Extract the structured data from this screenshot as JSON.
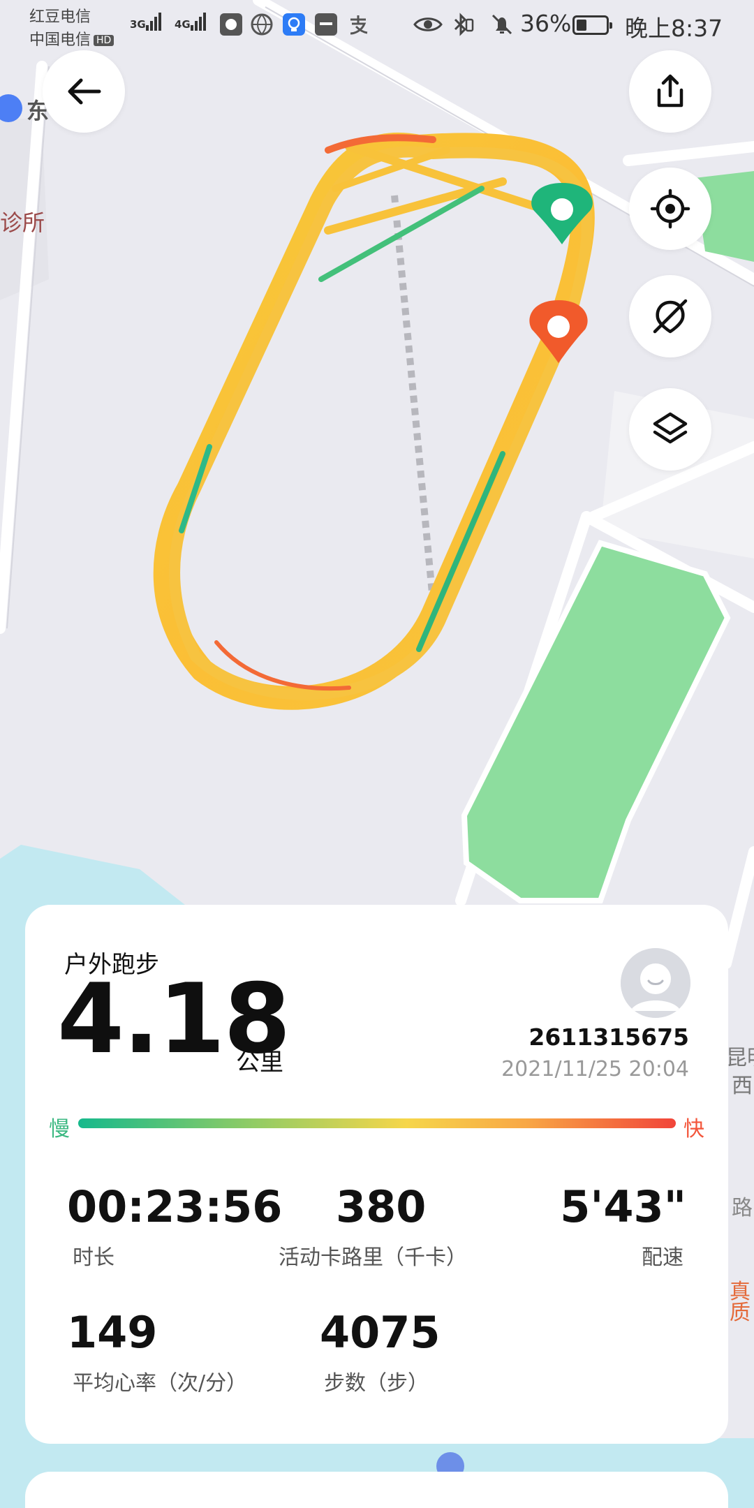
{
  "status_bar": {
    "carrier_1": "红豆电信",
    "carrier_2": "中国电信",
    "hd_badge": "HD",
    "net_1": "3G",
    "net_2": "4G",
    "battery_percent": "36%",
    "battery_level": 0.36,
    "time": "晚上8:37",
    "icons": [
      "signal-icon",
      "signal-icon",
      "app-icon",
      "globe-icon",
      "bulb-icon",
      "huawei-icon",
      "alipay-icon",
      "eye-icon",
      "bluetooth-icon",
      "vibrate-icon",
      "mute-icon",
      "battery-icon"
    ]
  },
  "map": {
    "labels": [
      "东",
      "诊所",
      "昆明",
      "西",
      "路",
      "真",
      "质"
    ],
    "colors": {
      "background": "#eaeaf0",
      "park": "#8ddd9e",
      "water": "#c2e9f1",
      "road": "#ffffff"
    }
  },
  "map_controls": {
    "back": "back-arrow-icon",
    "share": "share-icon",
    "locate": "locate-icon",
    "hide_route": "hide-route-icon",
    "layers": "layers-icon"
  },
  "route_markers": {
    "start_color": "#1fb57a",
    "end_color": "#f15a2b"
  },
  "summary": {
    "activity_type": "户外跑步",
    "distance": "4.18",
    "distance_unit": "公里",
    "user_id": "2611315675",
    "datetime": "2021/11/25 20:04",
    "pace_legend": {
      "slow": "慢",
      "fast": "快"
    },
    "stats": [
      {
        "value": "00:23:56",
        "label": "时长"
      },
      {
        "value": "380",
        "label": "活动卡路里（千卡）"
      },
      {
        "value": "5'43\"",
        "label": "配速"
      },
      {
        "value": "149",
        "label": "平均心率（次/分）"
      },
      {
        "value": "4075",
        "label": "步数（步）"
      }
    ]
  }
}
